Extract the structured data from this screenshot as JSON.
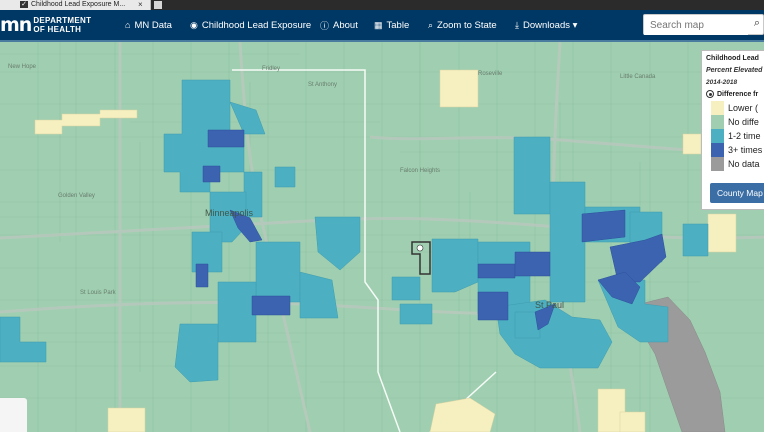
{
  "browser": {
    "tab_title": "Childhood Lead Exposure M...",
    "tab_close": "×"
  },
  "header": {
    "logo_mark": "mn",
    "logo_line1": "DEPARTMENT",
    "logo_line2": "OF HEALTH",
    "nav": [
      {
        "icon": "⌂",
        "label": "MN Data"
      },
      {
        "icon": "◉",
        "label": "Childhood Lead Exposure"
      },
      {
        "icon": "ⓘ",
        "label": "About"
      },
      {
        "icon": "▦",
        "label": "Table"
      },
      {
        "icon": "⌕",
        "label": "Zoom to State"
      },
      {
        "icon": "⤓",
        "label": "Downloads ▾"
      }
    ],
    "search_placeholder": "Search map",
    "search_icon": "⌕"
  },
  "map": {
    "place_labels": [
      "New Hope",
      "Fridley",
      "St Anthony",
      "Roseville",
      "Little Canada",
      "Golden Valley",
      "Minneapolis",
      "Falcon Heights",
      "St Louis Park",
      "St Paul"
    ],
    "colors": {
      "lower": "#f6efbf",
      "no_diff": "#9fcfb0",
      "one_two": "#4dafc2",
      "three_plus": "#3b63b0",
      "no_data": "#9b9b9b"
    }
  },
  "legend": {
    "title": "Childhood Lead",
    "subtitle": "Percent Elevated",
    "years": "2014-2018",
    "mode_label": "Difference fr",
    "items": [
      {
        "label": "Lower (",
        "color": "#f6efbf"
      },
      {
        "label": "No diffe",
        "color": "#9fcfb0"
      },
      {
        "label": "1-2 time",
        "color": "#4dafc2"
      },
      {
        "label": "3+ times",
        "color": "#3b63b0"
      },
      {
        "label": "No data",
        "color": "#9b9b9b"
      }
    ],
    "county_button": "County Map"
  }
}
